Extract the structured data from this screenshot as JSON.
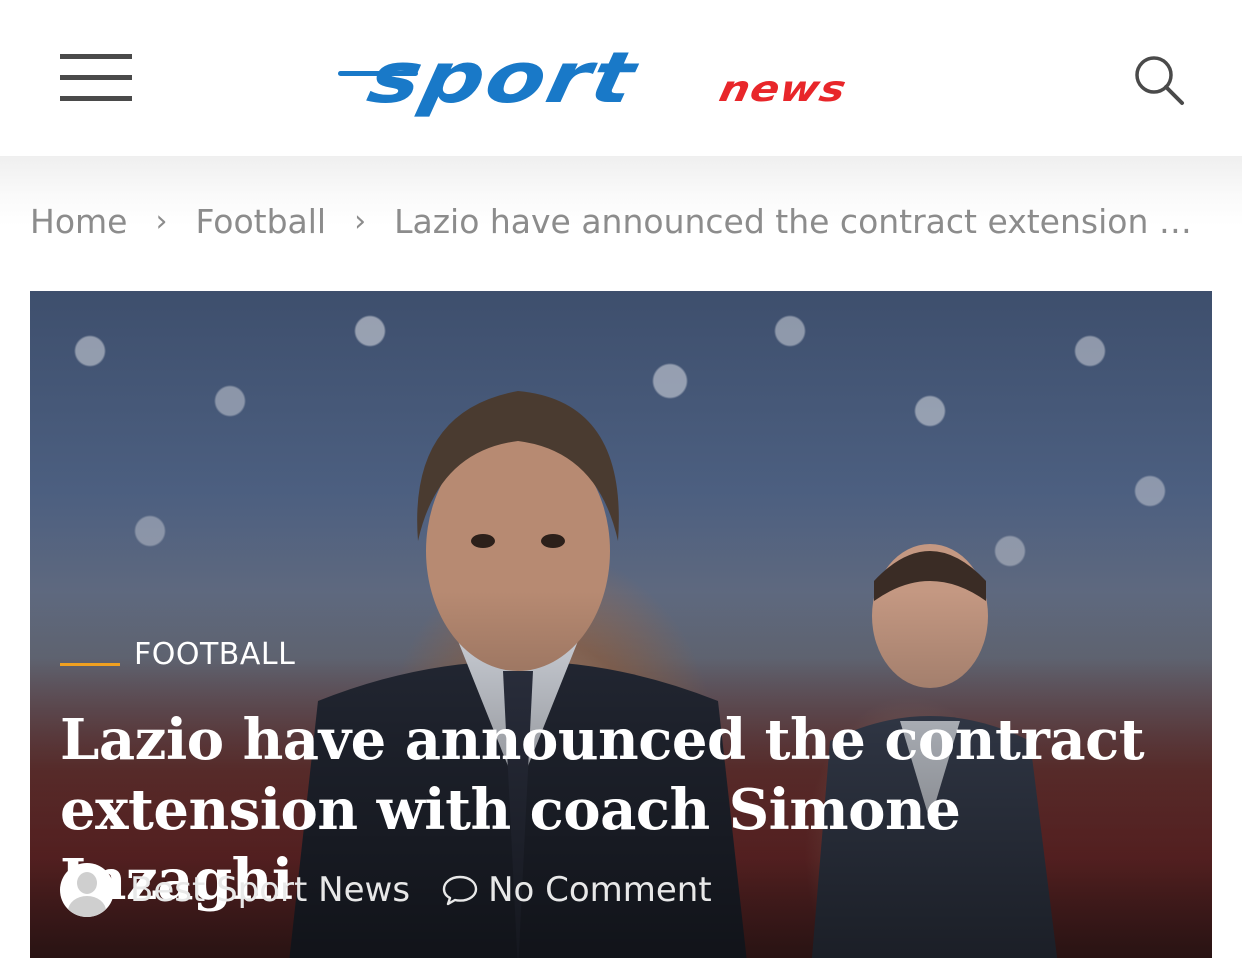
{
  "header": {
    "logo_primary": "sport",
    "logo_secondary": "news",
    "brand_colors": {
      "primary": "#1979c8",
      "secondary": "#e8262a"
    },
    "menu_icon": "hamburger-icon",
    "search_icon": "search-icon"
  },
  "breadcrumb": {
    "items": [
      "Home",
      "Football"
    ],
    "current": "Lazio have announced the contract extension with co...",
    "separator": "›"
  },
  "article": {
    "category": "FOOTBALL",
    "category_accent": "#f0a020",
    "title": "Lazio have announced the contract extension with coach Simone Inzaghi",
    "author": "Best Sport News",
    "comments": "No Comment",
    "comment_icon": "comment-icon",
    "avatar_icon": "avatar-icon"
  }
}
